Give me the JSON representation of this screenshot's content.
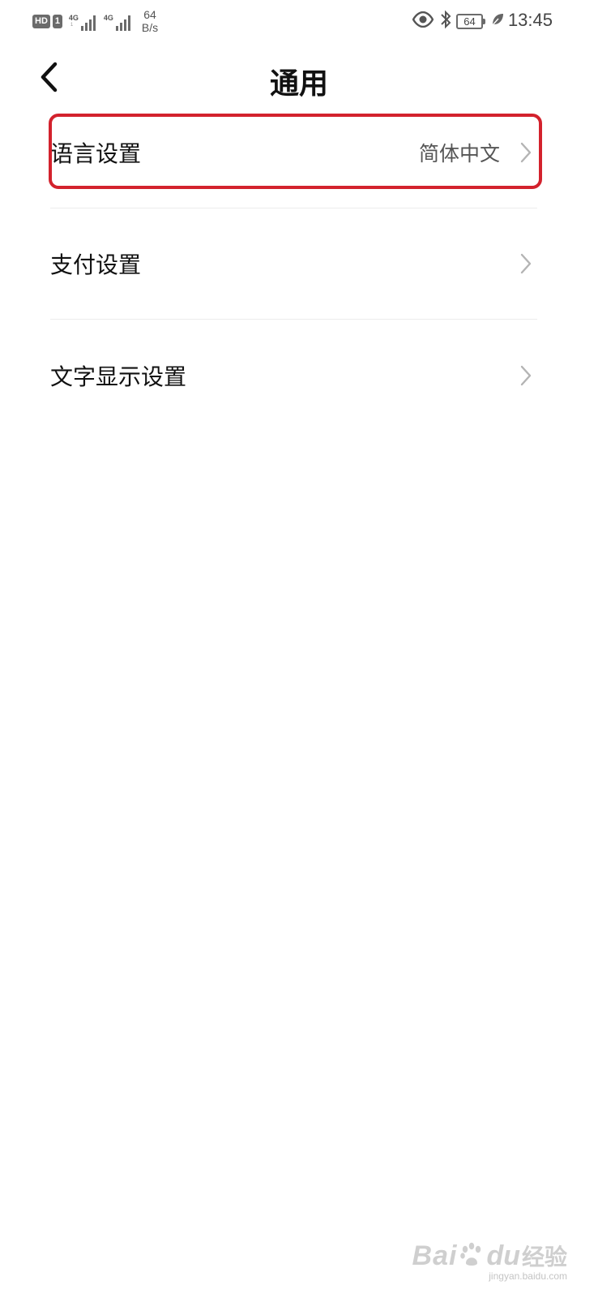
{
  "status_bar": {
    "hd": "HD",
    "sim": "1",
    "net1": "4G",
    "net1_sub": "1",
    "net2": "4G",
    "speed_value": "64",
    "speed_unit": "B/s",
    "battery": "64",
    "time": "13:45",
    "icons": [
      "eye-icon",
      "bluetooth-icon",
      "battery-icon",
      "leaf-icon"
    ]
  },
  "header": {
    "title": "通用",
    "back_icon": "back-arrow-icon"
  },
  "settings": {
    "items": [
      {
        "label": "语言设置",
        "value": "简体中文",
        "icon": "chevron-right-icon",
        "highlighted": true
      },
      {
        "label": "支付设置",
        "value": "",
        "icon": "chevron-right-icon"
      },
      {
        "label": "文字显示设置",
        "value": "",
        "icon": "chevron-right-icon"
      }
    ]
  },
  "highlight_color": "#d3222d",
  "watermark": {
    "bai": "Bai",
    "du": "du",
    "jingyan": "经验",
    "url": "jingyan.baidu.com"
  }
}
